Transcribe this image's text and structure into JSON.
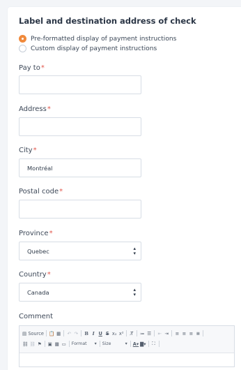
{
  "section": {
    "title": "Label and destination address of check"
  },
  "display_options": [
    {
      "label": "Pre-formatted display of payment instructions",
      "checked": true
    },
    {
      "label": "Custom display of payment instructions",
      "checked": false
    }
  ],
  "fields": {
    "pay_to": {
      "label": "Pay to",
      "required_mark": "*",
      "value": ""
    },
    "address": {
      "label": "Address",
      "required_mark": "*",
      "value": ""
    },
    "city": {
      "label": "City",
      "required_mark": "*",
      "value": "Montréal"
    },
    "postal_code": {
      "label": "Postal code",
      "required_mark": "*",
      "value": ""
    },
    "province": {
      "label": "Province",
      "required_mark": "*",
      "value": "Quebec"
    },
    "country": {
      "label": "Country",
      "required_mark": "*",
      "value": "Canada"
    },
    "comment": {
      "label": "Comment"
    }
  },
  "editor_toolbar": {
    "source_label": "Source",
    "format_label": "Format",
    "size_label": "Size"
  },
  "colors": {
    "accent": "#f08a3c",
    "required": "#e2574c",
    "border": "#d7dde5"
  }
}
